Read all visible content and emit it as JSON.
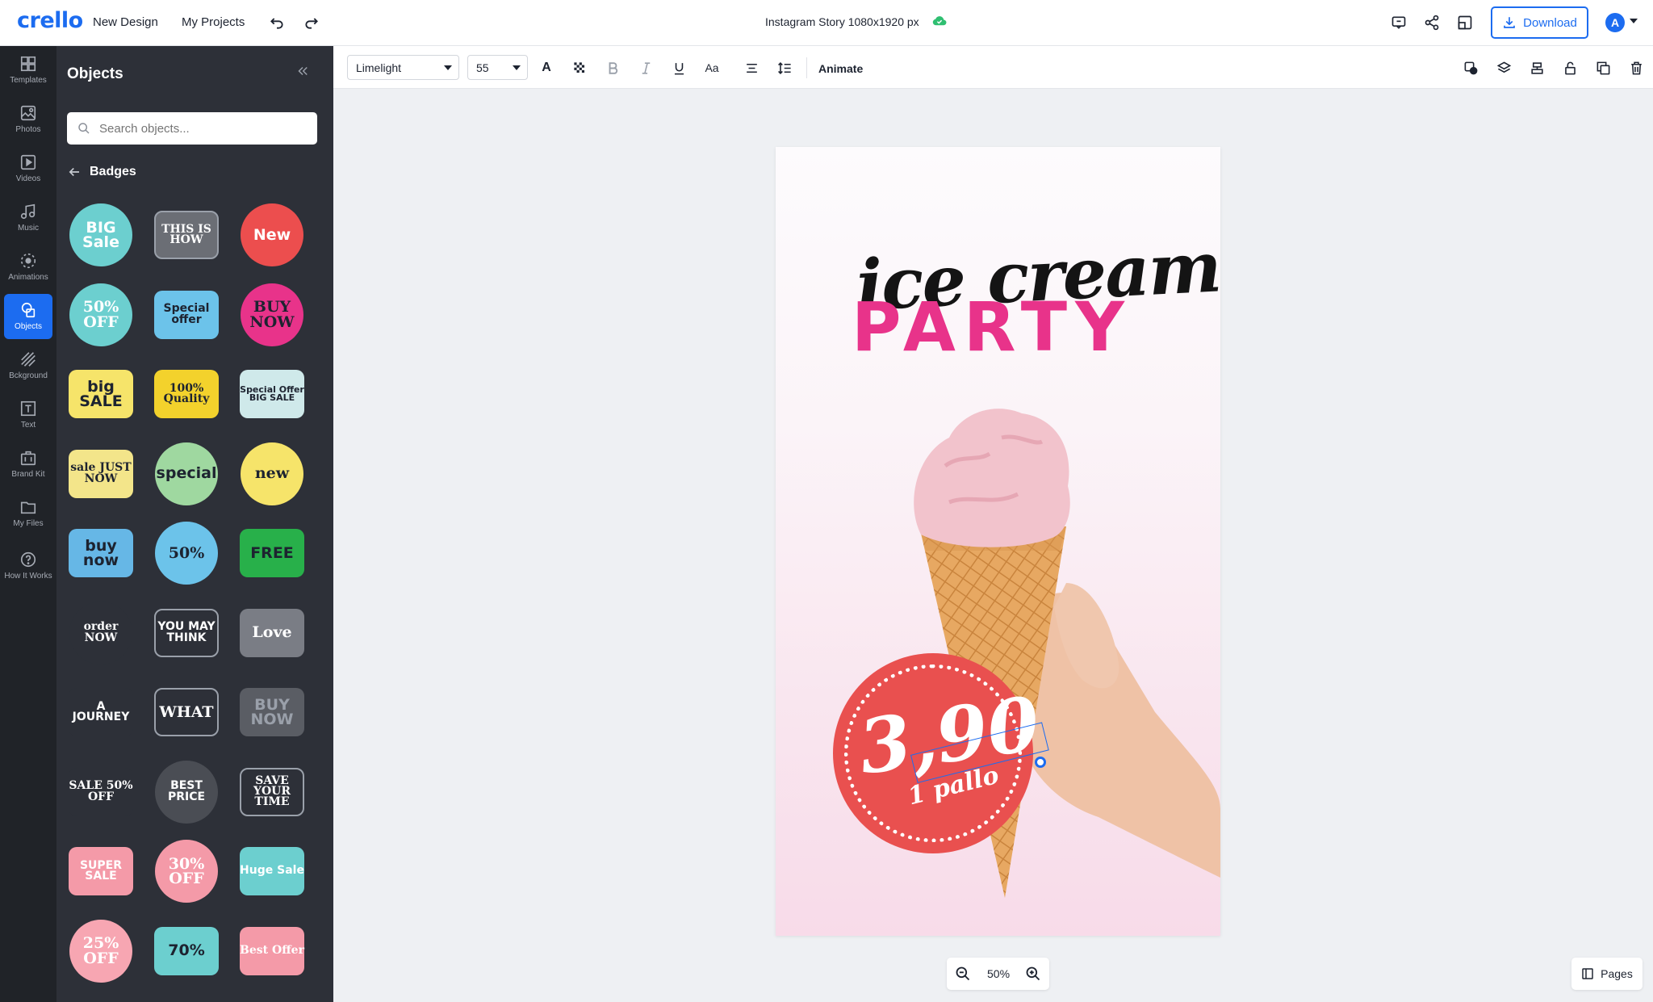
{
  "header": {
    "logo": "crello",
    "nav": [
      "New Design",
      "My Projects"
    ],
    "doc_title": "Instagram Story 1080x1920 px",
    "download_label": "Download",
    "avatar_letter": "A"
  },
  "rail": [
    {
      "label": "Templates",
      "icon": "templates-icon"
    },
    {
      "label": "Photos",
      "icon": "photos-icon"
    },
    {
      "label": "Videos",
      "icon": "videos-icon"
    },
    {
      "label": "Music",
      "icon": "music-icon"
    },
    {
      "label": "Animations",
      "icon": "animations-icon"
    },
    {
      "label": "Objects",
      "icon": "objects-icon",
      "active": true
    },
    {
      "label": "Bckground",
      "icon": "background-icon"
    },
    {
      "label": "Text",
      "icon": "text-icon"
    },
    {
      "label": "Brand Kit",
      "icon": "brand-kit-icon"
    },
    {
      "label": "My Files",
      "icon": "my-files-icon"
    },
    {
      "label": "How It Works",
      "icon": "help-icon"
    }
  ],
  "panel": {
    "title": "Objects",
    "search_placeholder": "Search objects...",
    "section": "Badges",
    "badges": [
      {
        "text": "BIG Sale",
        "bg": "#6ccfcf",
        "fg": "#ffffff"
      },
      {
        "text": "THIS IS HOW",
        "bg": "#6b6e75",
        "fg": "#ffffff"
      },
      {
        "text": "New",
        "bg": "#ec4e4e",
        "fg": "#ffffff"
      },
      {
        "text": "50% OFF",
        "bg": "#6ccfcf",
        "fg": "#ffffff"
      },
      {
        "text": "Special offer",
        "bg": "#6cc3ea",
        "fg": "#1d2330"
      },
      {
        "text": "BUY NOW",
        "bg": "#e8338a",
        "fg": "#1d2330"
      },
      {
        "text": "big SALE",
        "bg": "#f6e46a",
        "fg": "#1d2330"
      },
      {
        "text": "100% Quality",
        "bg": "#f3d22c",
        "fg": "#1d2330"
      },
      {
        "text": "Special Offer BIG SALE",
        "bg": "#cfe9ea",
        "fg": "#1d2330"
      },
      {
        "text": "sale JUST NOW",
        "bg": "#f3e58a",
        "fg": "#1d2330"
      },
      {
        "text": "special",
        "bg": "#9fd8a0",
        "fg": "#1d2330"
      },
      {
        "text": "new",
        "bg": "#f6e46a",
        "fg": "#1d2330"
      },
      {
        "text": "buy now",
        "bg": "#66b7e6",
        "fg": "#1d2330"
      },
      {
        "text": "50%",
        "bg": "#6cc3ea",
        "fg": "#1d2330"
      },
      {
        "text": "FREE",
        "bg": "#28b04a",
        "fg": "#1d2330"
      },
      {
        "text": "order NOW",
        "bg": "#2d3038",
        "fg": "#ffffff"
      },
      {
        "text": "YOU MAY THINK",
        "bg": "#2d3038",
        "fg": "#ffffff"
      },
      {
        "text": "Love",
        "bg": "#7a7d85",
        "fg": "#ffffff"
      },
      {
        "text": "A JOURNEY",
        "bg": "#2d3038",
        "fg": "#ffffff"
      },
      {
        "text": "WHAT",
        "bg": "#2d3038",
        "fg": "#ffffff"
      },
      {
        "text": "BUY NOW",
        "bg": "#5a5d64",
        "fg": "#9aa0aa"
      },
      {
        "text": "SALE 50% OFF",
        "bg": "#2d3038",
        "fg": "#ffffff"
      },
      {
        "text": "BEST PRICE",
        "bg": "#4a4d54",
        "fg": "#ffffff"
      },
      {
        "text": "SAVE YOUR TIME",
        "bg": "#2d3038",
        "fg": "#ffffff"
      },
      {
        "text": "SUPER SALE",
        "bg": "#f49aa8",
        "fg": "#ffffff"
      },
      {
        "text": "30% OFF",
        "bg": "#f49aa8",
        "fg": "#ffffff"
      },
      {
        "text": "Huge Sale",
        "bg": "#6ccfcf",
        "fg": "#ffffff"
      },
      {
        "text": "25% OFF",
        "bg": "#f7a6b2",
        "fg": "#ffffff"
      },
      {
        "text": "70%",
        "bg": "#6ccfcf",
        "fg": "#1d2330"
      },
      {
        "text": "Best Offer",
        "bg": "#f49aa8",
        "fg": "#ffffff"
      }
    ]
  },
  "toolbar": {
    "font": "Limelight",
    "size": "55",
    "animate": "Animate",
    "text_buttons": [
      "A",
      "Aa"
    ]
  },
  "canvas": {
    "title_line1": "ice cream",
    "title_line2": "PARTY",
    "price": "3,90",
    "sub": "1 pallo"
  },
  "zoom": {
    "value": "50%"
  },
  "pages_label": "Pages",
  "colors": {
    "accent": "#1c6cf0",
    "pink": "#e8338a",
    "coral": "#e9504f"
  }
}
